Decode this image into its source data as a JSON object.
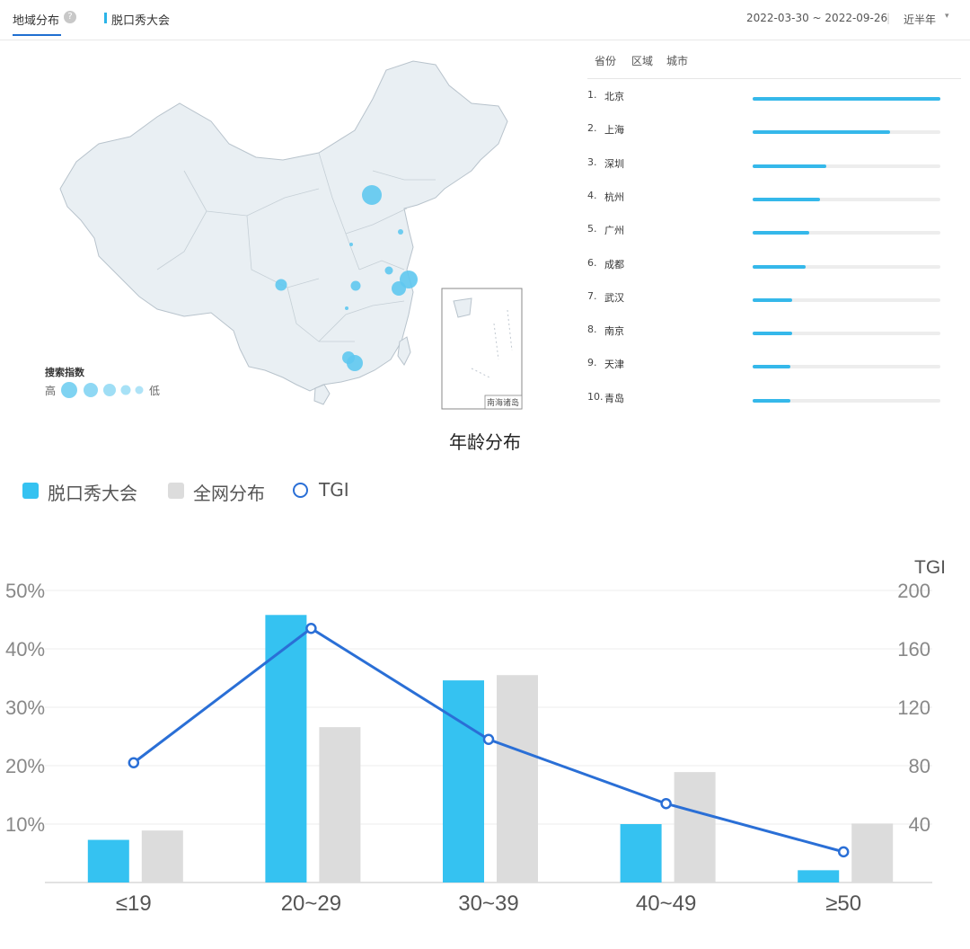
{
  "header": {
    "tab_label": "地域分布",
    "help_icon": "?",
    "keyword": "脱口秀大会",
    "date_range": "2022-03-30 ~ 2022-09-26",
    "separator": "|",
    "period": "近半年",
    "period_caret": "▾"
  },
  "ranking": {
    "tabs": [
      "省份",
      "区域",
      "城市"
    ],
    "items": [
      {
        "num": "1.",
        "city": "北京",
        "share": 1.0
      },
      {
        "num": "2.",
        "city": "上海",
        "share": 0.73
      },
      {
        "num": "3.",
        "city": "深圳",
        "share": 0.39
      },
      {
        "num": "4.",
        "city": "杭州",
        "share": 0.36
      },
      {
        "num": "5.",
        "city": "广州",
        "share": 0.3
      },
      {
        "num": "6.",
        "city": "成都",
        "share": 0.28
      },
      {
        "num": "7.",
        "city": "武汉",
        "share": 0.21
      },
      {
        "num": "8.",
        "city": "南京",
        "share": 0.21
      },
      {
        "num": "9.",
        "city": "天津",
        "share": 0.2
      },
      {
        "num": "10.",
        "city": "青岛",
        "share": 0.2
      }
    ],
    "bar_color": "#35b8ea"
  },
  "map": {
    "legend_title": "搜索指数",
    "legend_high": "高",
    "legend_low": "低",
    "inset_label": "南海诸岛",
    "bubble_color": "#5fc8ef"
  },
  "age": {
    "title": "年龄分布",
    "legend": {
      "brand": "脱口秀大会",
      "overall": "全网分布",
      "tgi": "TGI"
    },
    "colors": {
      "brand": "#35c2f1",
      "overall": "#dcdcdc",
      "tgi": "#2a6fd6"
    }
  },
  "chart_data": {
    "type": "bar",
    "title": "年龄分布",
    "categories": [
      "≤19",
      "20~29",
      "30~39",
      "40~49",
      "≥50"
    ],
    "series": [
      {
        "name": "脱口秀大会",
        "values": [
          7.3,
          45.8,
          34.6,
          10.0,
          2.1
        ]
      },
      {
        "name": "全网分布",
        "values": [
          8.9,
          26.6,
          35.5,
          18.9,
          10.1
        ]
      },
      {
        "name": "TGI",
        "values": [
          82,
          174,
          98,
          54,
          21
        ],
        "axis": "right",
        "type": "line"
      }
    ],
    "y_left": {
      "ticks": [
        "10%",
        "20%",
        "30%",
        "40%",
        "50%"
      ],
      "ylim": [
        0,
        50
      ]
    },
    "y_right": {
      "label": "TGI",
      "ticks": [
        "40",
        "80",
        "120",
        "160",
        "200"
      ],
      "ylim": [
        0,
        200
      ]
    },
    "grid": true,
    "legend_position": "top-left"
  }
}
